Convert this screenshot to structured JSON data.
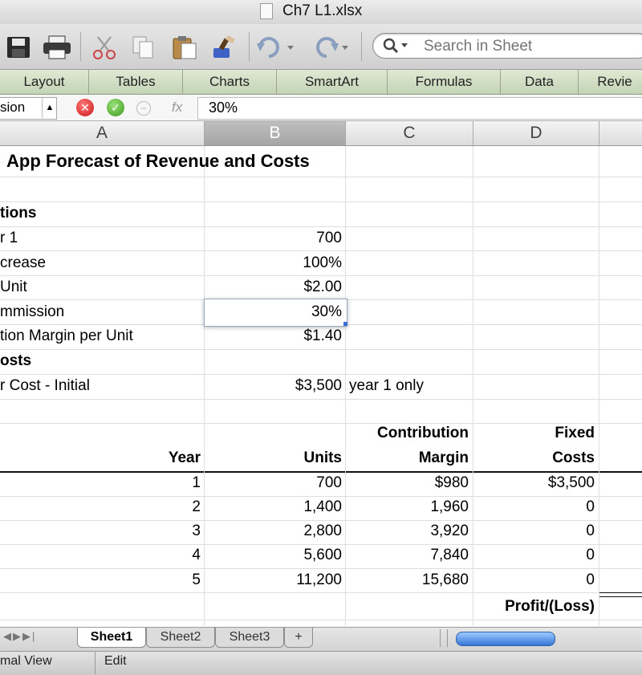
{
  "window": {
    "title": "Ch7 L1.xlsx"
  },
  "toolbar": {
    "icons": [
      "save-icon",
      "print-icon",
      "cut-icon",
      "copy-icon",
      "paste-icon",
      "format-painter-icon",
      "undo-icon",
      "redo-icon"
    ],
    "search_placeholder": "Search in Sheet"
  },
  "ribbon": {
    "tabs": [
      "Layout",
      "Tables",
      "Charts",
      "SmartArt",
      "Formulas",
      "Data",
      "Revie"
    ]
  },
  "formula_bar": {
    "name_box": "sion",
    "fx": "fx",
    "content": "30%"
  },
  "columns": [
    "A",
    "B",
    "C",
    "D"
  ],
  "selected_column": "B",
  "sheet": {
    "title": "App Forecast of Revenue and Costs",
    "assumptions_header": "tions",
    "assumptions": [
      {
        "label": "r 1",
        "value": "700"
      },
      {
        "label": "crease",
        "value": "100%"
      },
      {
        "label": " Unit",
        "value": "$2.00"
      },
      {
        "label": "mmission",
        "value": "30%"
      },
      {
        "label": "tion Margin per Unit",
        "value": "$1.40"
      }
    ],
    "costs_header": "osts",
    "cost_items": [
      {
        "label": "r Cost - Initial",
        "value": "$3,500",
        "note": "year 1 only"
      }
    ],
    "table_headers": {
      "year": "Year",
      "units": "Units",
      "contribution_top": "Contribution",
      "contribution_bottom": "Margin",
      "fixed_top": "Fixed",
      "fixed_bottom": "Costs"
    },
    "rows": [
      {
        "year": "1",
        "units": "700",
        "margin": "$980",
        "fixed": "$3,500"
      },
      {
        "year": "2",
        "units": "1,400",
        "margin": "1,960",
        "fixed": "0"
      },
      {
        "year": "3",
        "units": "2,800",
        "margin": "3,920",
        "fixed": "0"
      },
      {
        "year": "4",
        "units": "5,600",
        "margin": "7,840",
        "fixed": "0"
      },
      {
        "year": "5",
        "units": "11,200",
        "margin": "15,680",
        "fixed": "0"
      }
    ],
    "profit_label": "Profit/(Loss)"
  },
  "sheet_tabs": [
    "Sheet1",
    "Sheet2",
    "Sheet3",
    "+"
  ],
  "active_sheet": "Sheet1",
  "status_bar": {
    "view": "mal View",
    "mode": "Edit"
  }
}
